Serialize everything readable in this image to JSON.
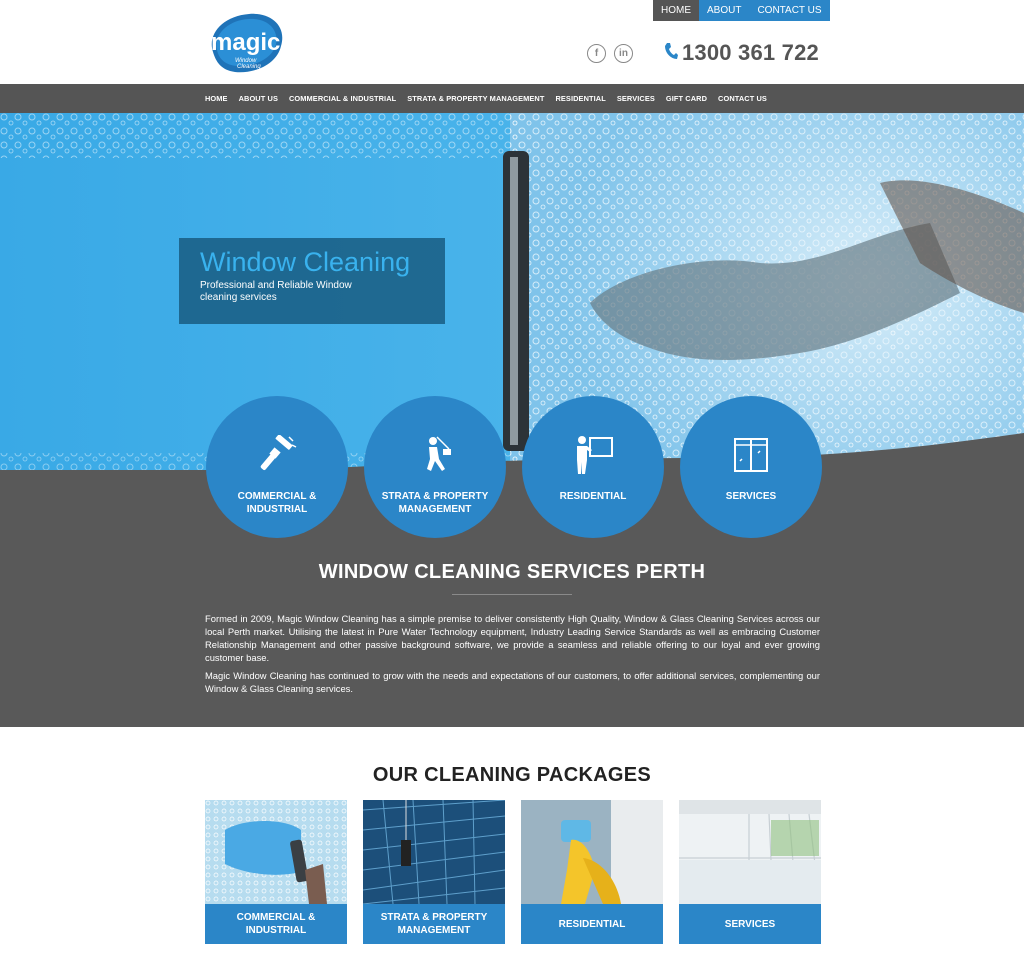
{
  "brand": {
    "logo_word": "magic",
    "logo_sub": "Window Cleaning",
    "colors": {
      "primary_blue": "#2b86c8",
      "dark_grey": "#555555",
      "section_grey": "#595959",
      "hero_title": "#39b2ee"
    }
  },
  "top_links": [
    {
      "label": "HOME",
      "active": true
    },
    {
      "label": "ABOUT",
      "active": false
    },
    {
      "label": "CONTACT US",
      "active": false
    }
  ],
  "socials": {
    "facebook_icon": "f",
    "linkedin_icon": "in"
  },
  "phone": {
    "icon": "phone-icon",
    "number": "1300 361 722"
  },
  "nav": [
    "HOME",
    "ABOUT US",
    "COMMERCIAL & INDUSTRIAL",
    "STRATA & PROPERTY MANAGEMENT",
    "RESIDENTIAL",
    "SERVICES",
    "GIFT CARD",
    "CONTACT US"
  ],
  "hero": {
    "title": "Window Cleaning",
    "subtitle": "Professional and Reliable Window cleaning services"
  },
  "service_circles": [
    {
      "label1": "COMMERCIAL &",
      "label2": "INDUSTRIAL",
      "icon": "squeegee-icon"
    },
    {
      "label1": "STRATA & PROPERTY",
      "label2": "MANAGEMENT",
      "icon": "abseil-worker-icon"
    },
    {
      "label1": "RESIDENTIAL",
      "label2": "",
      "icon": "person-cleaning-window-icon"
    },
    {
      "label1": "SERVICES",
      "label2": "",
      "icon": "window-frame-icon"
    }
  ],
  "about": {
    "title": "WINDOW CLEANING SERVICES PERTH",
    "paragraph1": "Formed in 2009, Magic Window Cleaning has a simple premise to deliver consistently High Quality, Window & Glass Cleaning Services across our local Perth market. Utilising the latest in Pure Water Technology equipment, Industry Leading Service Standards as well as embracing Customer Relationship Management and other passive background software, we provide a seamless and reliable offering to our loyal and ever growing customer base.",
    "paragraph2": "Magic Window Cleaning has continued to grow with the needs and expectations of our customers, to offer additional services, complementing our Window & Glass Cleaning services."
  },
  "packages": {
    "title": "OUR CLEANING PACKAGES",
    "cards": [
      {
        "label1": "COMMERCIAL &",
        "label2": "INDUSTRIAL"
      },
      {
        "label1": "STRATA & PROPERTY",
        "label2": "MANAGEMENT"
      },
      {
        "label1": "RESIDENTIAL",
        "label2": ""
      },
      {
        "label1": "SERVICES",
        "label2": ""
      }
    ]
  }
}
